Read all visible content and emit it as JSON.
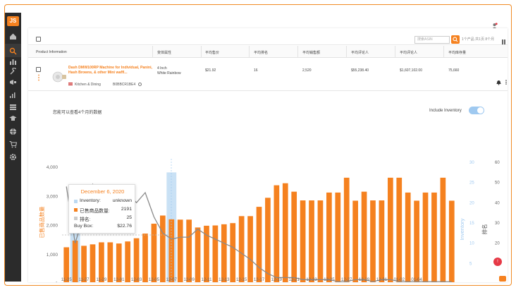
{
  "sidebar": {
    "logo": "JS",
    "icons": [
      "home-icon",
      "search-icon",
      "chart-bars-icon",
      "wrench-icon",
      "megaphone-icon",
      "analytics-icon",
      "graduation-icon",
      "cap-icon",
      "globe-icon",
      "cart-icon",
      "gear-icon"
    ]
  },
  "toolbar": {
    "search_placeholder": "搜索ASIN",
    "meta": "1个产品  共1页  8个月",
    "user_icon": "user-icon"
  },
  "table": {
    "headers": [
      "Product Information",
      "变体属性",
      "平均售价",
      "平均排名",
      "平均销售额",
      "平均评论人",
      "平均评论人",
      "平均库存量"
    ],
    "row": {
      "title": "Dash DMW100RP Machine for Individual, Panini, Hash Browns, & other Mini waffl...",
      "category": "Kitchen & Dining",
      "asin": "B0BBCR1BE4",
      "variant_line1": "4 Inch",
      "variant_line2": "White Rainbow",
      "price": "$21.92",
      "rank": "16",
      "sales": "2,520",
      "revenue": "$55,238.40",
      "reviewers": "$1,607,102.00",
      "inventory": "75,660"
    }
  },
  "chart_header": {
    "title": "您能可以查看4个月的数据",
    "toggle_label": "Include Inventory",
    "toggle_on": true
  },
  "tooltip": {
    "date": "December 6, 2020",
    "rows": [
      {
        "name": "Inventory:",
        "value": "unknown",
        "color": "#bcd9f2"
      },
      {
        "name": "已售商品数量:",
        "value": "2191",
        "color": "#f5811f"
      },
      {
        "name": "排名:",
        "value": "25",
        "color": "#cccccc"
      },
      {
        "name": "Buy Box:",
        "value": "$22.76",
        "color": ""
      }
    ]
  },
  "chart_data": {
    "type": "bar",
    "ylabel_left": "已售商品数量",
    "ylabel_mid": "Inventory",
    "ylabel_right": "排名",
    "ylim": [
      0,
      4000
    ],
    "ylim_mid": [
      0,
      30
    ],
    "ylim_right": [
      0,
      60
    ],
    "yticks_left": [
      "0",
      "1,000",
      "2,000",
      "3,000",
      "4,000"
    ],
    "yticks_mid": [
      "0",
      "5",
      "10",
      "15",
      "20",
      "25",
      "30"
    ],
    "yticks_right": [
      "0",
      "10",
      "20",
      "30",
      "40",
      "50",
      "60"
    ],
    "xtick_labels": [
      "11-25",
      "11-27",
      "11-29",
      "12-01",
      "12-03",
      "12-05",
      "12-07",
      "12-09",
      "12-11",
      "12-13",
      "12-15",
      "12-17",
      "12-19",
      "12-21",
      "12-23",
      "12-25",
      "12-27",
      "12-29",
      "12-31",
      "01-02",
      "01-04"
    ],
    "bar_color": "#f5811f",
    "highlight_color": "#bcd9f2",
    "values": [
      1250,
      1480,
      1300,
      1350,
      1420,
      1420,
      1380,
      1450,
      1560,
      1720,
      2060,
      2340,
      2210,
      2200,
      2200,
      1930,
      1990,
      2000,
      2040,
      2080,
      2320,
      2320,
      2640,
      2950,
      3380,
      3450,
      3160,
      2860,
      2860,
      2860,
      3130,
      3130,
      3640,
      2850,
      3160,
      2860,
      2860,
      3640,
      3640,
      3130,
      2850,
      3130,
      3130,
      3640,
      2850
    ],
    "inventory_highlights": [
      {
        "index": 1,
        "value": 16
      },
      {
        "index": 12,
        "value": 27.5
      }
    ],
    "rank_series": [
      48,
      20,
      34,
      49,
      40,
      46,
      40,
      45,
      40,
      45,
      33,
      25,
      22,
      23,
      23,
      27,
      24,
      22,
      20,
      18,
      15,
      12,
      8,
      5,
      3,
      3,
      3,
      2,
      2,
      2,
      2,
      1,
      1,
      2,
      2,
      1,
      2,
      2,
      1,
      1,
      1,
      1,
      1,
      1,
      1
    ]
  }
}
